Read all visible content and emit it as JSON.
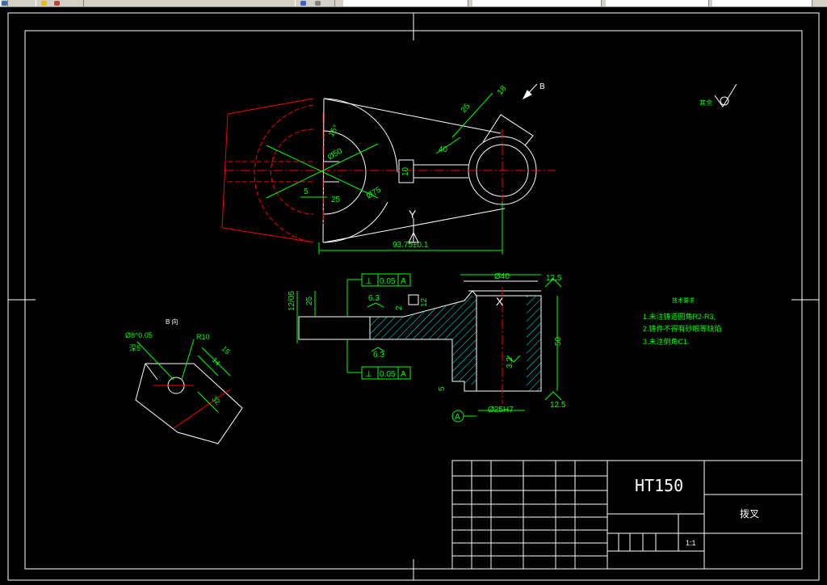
{
  "toolbar": {
    "icons": [
      "app-icon",
      "layer-icon",
      "color-icon",
      "linetype-icon",
      "lineweight-icon"
    ]
  },
  "drawing": {
    "view_labels": {
      "arrow_b": "B",
      "y_direction": "Y",
      "x_direction": "X",
      "datum_a": "A",
      "b_view_title": "B 向"
    },
    "top_view_dims": {
      "d_angle_upper": "15°",
      "dia_50": "Ø50",
      "dia_75": "Ø75",
      "dim_5": "5",
      "dim_25": "25",
      "dim_10": "10",
      "dim_40": "40",
      "dim_25b": "25",
      "dim_18": "18",
      "dim_93": "93.75±0.1"
    },
    "section_dims": {
      "gt1_symbol": "⊥",
      "gt1_value": "0.05",
      "gt1_datum": "A",
      "gt2_symbol": "⊥",
      "gt2_value": "0.05",
      "gt2_datum": "A",
      "dim_12": "12/05",
      "dim_25": "25",
      "rough_63a": "6.3",
      "rough_63b": "6.3",
      "dim_2": "2",
      "dim_12b": "12",
      "dia_40": "Ø40",
      "rough_125a": "12.5",
      "rough_125b": "12.5",
      "dim_50": "50",
      "rough_32": "3.2",
      "dim_5": "5",
      "dia_25": "Ø25H7"
    },
    "b_view_dims": {
      "dia_8": "Ø8^0.05",
      "deep_5": "深5",
      "r10": "R10",
      "dim_15": "15",
      "dim_14": "14",
      "dim_32": "32"
    },
    "roughness_note": "其余",
    "tech_requirements": {
      "title": "技术要求",
      "items": [
        "1.未注铸造圆角R2-R3,",
        "2.铸件不得有砂眼等缺陷",
        "3.未注倒角C1."
      ]
    }
  },
  "title_block": {
    "material": "HT150",
    "part_name": "拨叉",
    "scale": "1:1"
  },
  "colors": {
    "background": "#000000",
    "outline": "#ffffff",
    "centerline": "#ff0000",
    "dimension": "#00ff00",
    "hatch": "#00ffff",
    "toolbar": "#d4d0c8"
  }
}
